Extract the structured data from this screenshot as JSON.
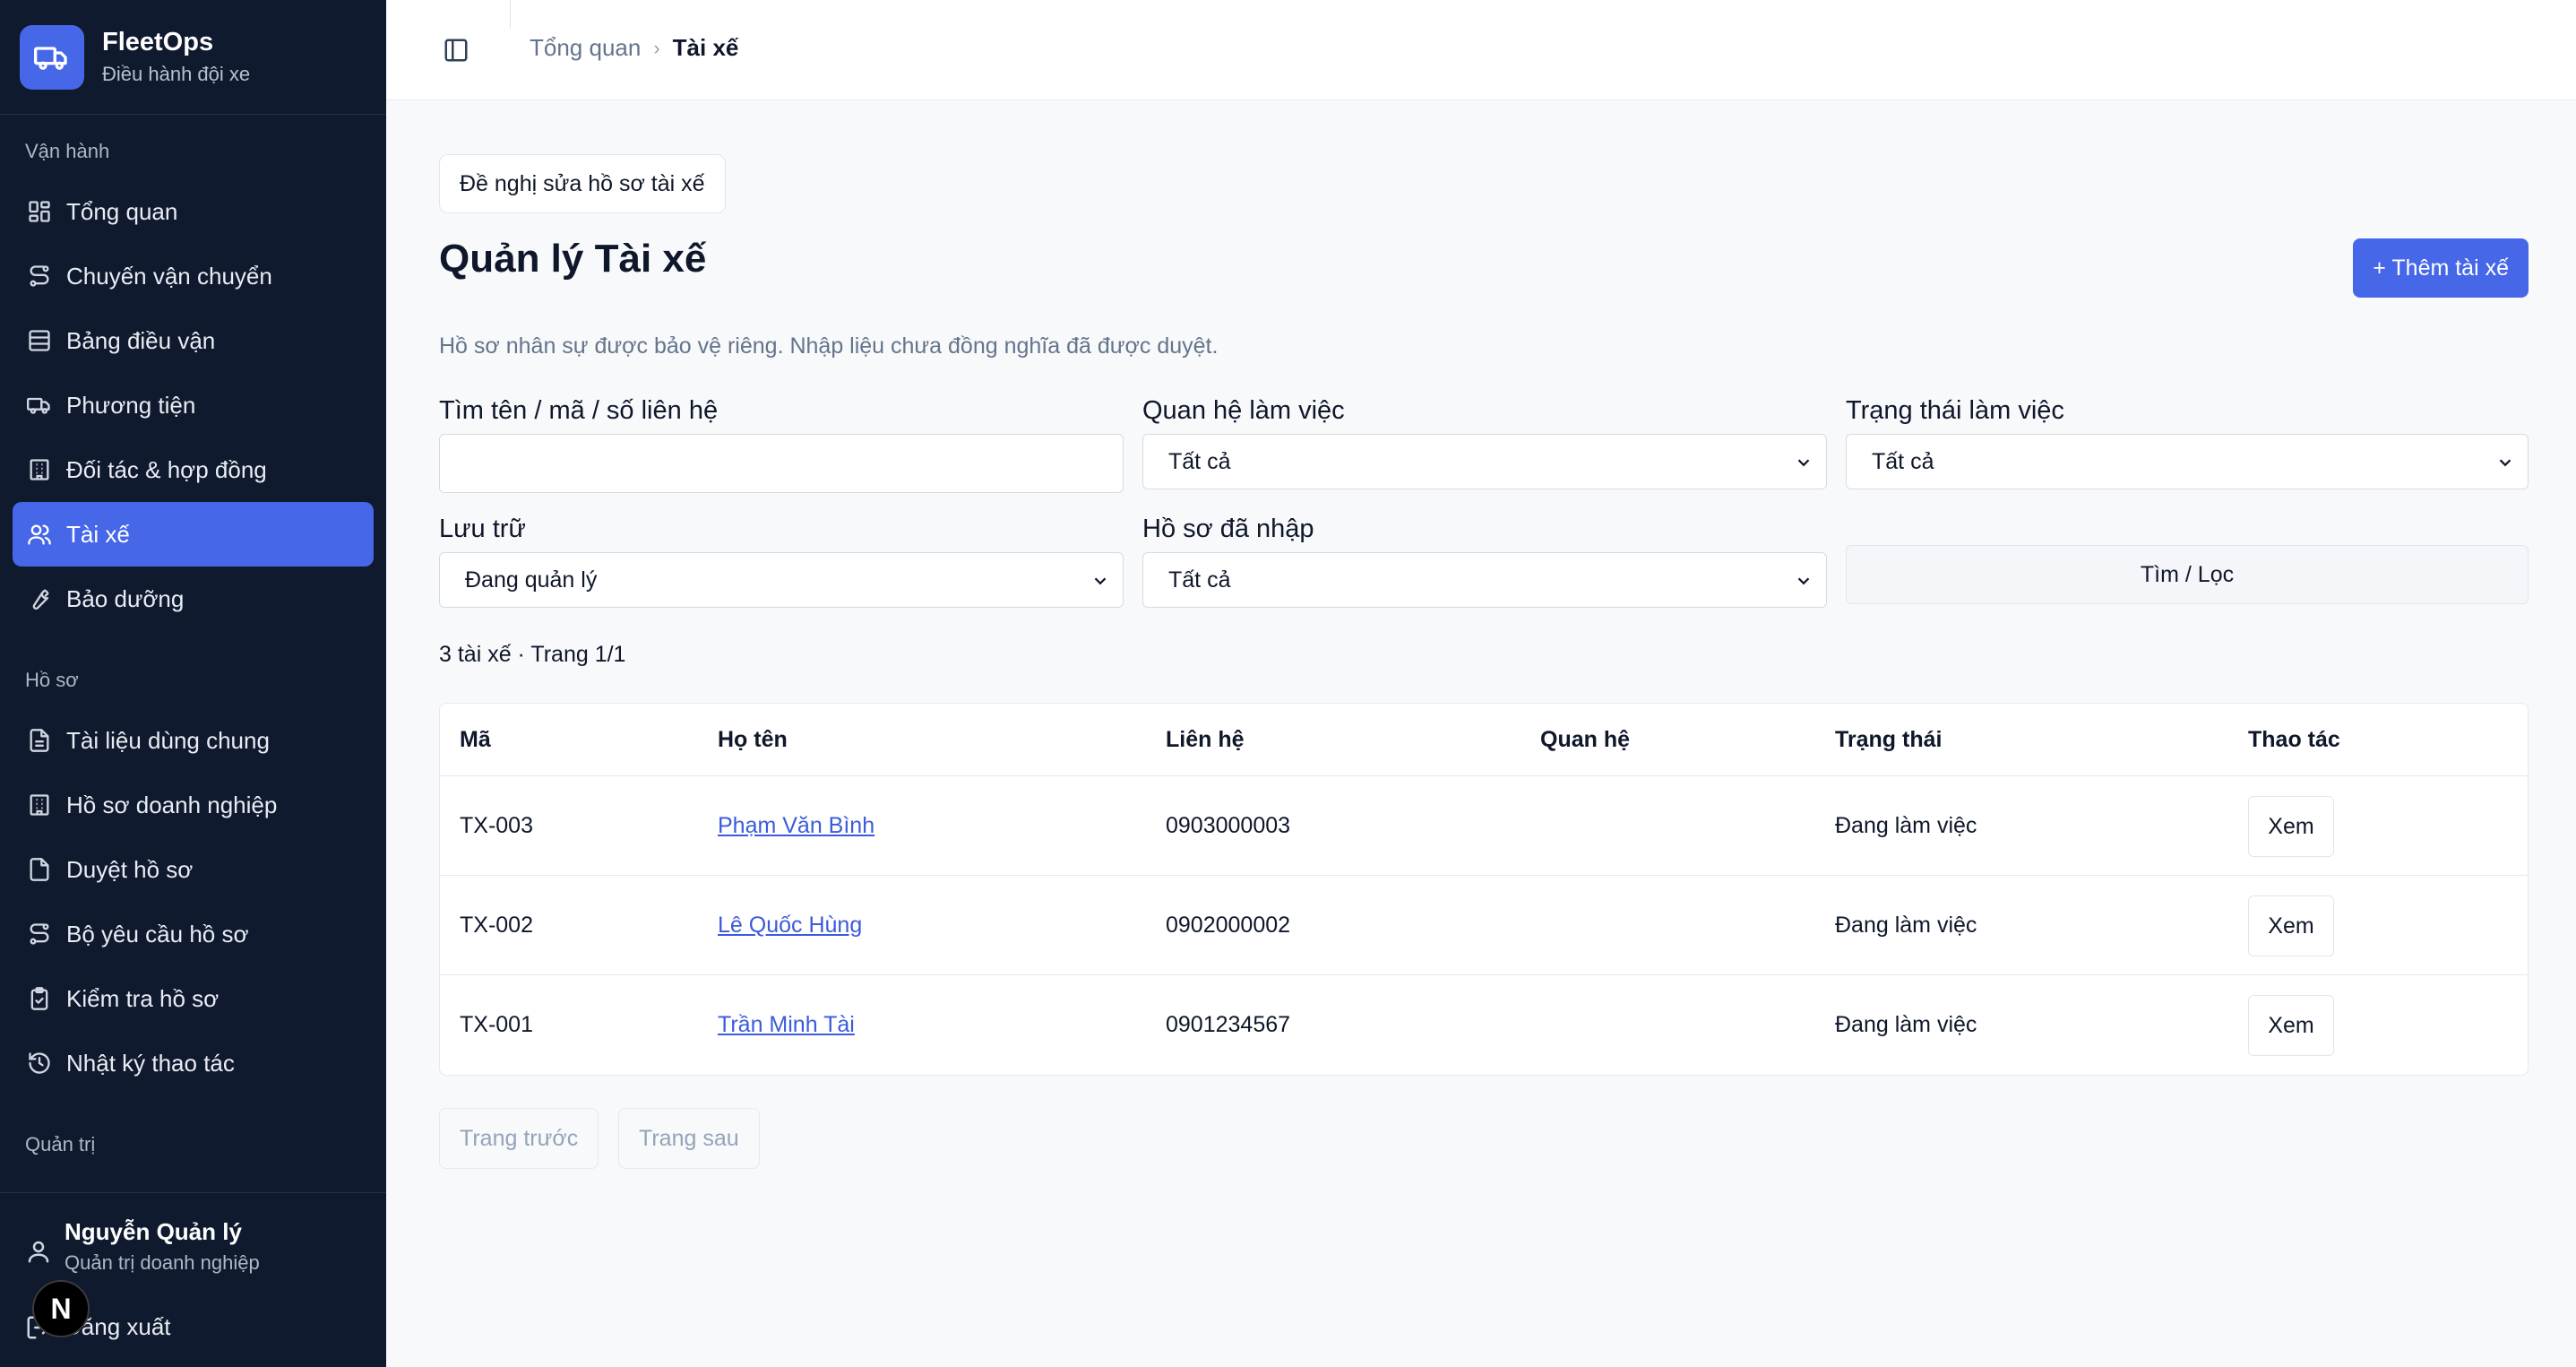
{
  "brand": {
    "name": "FleetOps",
    "subtitle": "Điều hành đội xe",
    "color": "#4567e8"
  },
  "sidebar": {
    "sections": [
      {
        "label": "Vận hành"
      },
      {
        "label": "Hồ sơ"
      },
      {
        "label": "Quản trị"
      }
    ],
    "items": [
      {
        "label": "Tổng quan",
        "icon": "dashboard-icon"
      },
      {
        "label": "Chuyến vận chuyển",
        "icon": "route-icon"
      },
      {
        "label": "Bảng điều vận",
        "icon": "table-icon"
      },
      {
        "label": "Phương tiện",
        "icon": "truck-icon"
      },
      {
        "label": "Đối tác & hợp đồng",
        "icon": "building-icon"
      },
      {
        "label": "Tài xế",
        "icon": "users-icon",
        "active": true
      },
      {
        "label": "Bảo dưỡng",
        "icon": "wrench-icon"
      },
      {
        "label": "Tài liệu dùng chung",
        "icon": "document-icon"
      },
      {
        "label": "Hồ sơ doanh nghiệp",
        "icon": "building-icon"
      },
      {
        "label": "Duyệt hồ sơ",
        "icon": "file-check-icon"
      },
      {
        "label": "Bộ yêu cầu hồ sơ",
        "icon": "route-icon"
      },
      {
        "label": "Kiểm tra hồ sơ",
        "icon": "clipboard-check-icon"
      },
      {
        "label": "Nhật ký thao tác",
        "icon": "history-icon"
      }
    ],
    "user": {
      "name": "Nguyễn Quản lý",
      "role": "Quản trị doanh nghiệp"
    },
    "logout_label": "Đăng xuất",
    "badge_letter": "N"
  },
  "breadcrumb": {
    "home": "Tổng quan",
    "current": "Tài xế"
  },
  "main": {
    "pill_label": "Đề nghị sửa hồ sơ tài xế",
    "title": "Quản lý Tài xế",
    "add_button": "+ Thêm tài xế",
    "subtitle": "Hồ sơ nhân sự được bảo vệ riêng. Nhập liệu chưa đồng nghĩa đã được duyệt."
  },
  "filters": {
    "search": {
      "label": "Tìm tên / mã / số liên hệ",
      "value": ""
    },
    "relation": {
      "label": "Quan hệ làm việc",
      "value": "Tất cả"
    },
    "status": {
      "label": "Trạng thái làm việc",
      "value": "Tất cả"
    },
    "archive": {
      "label": "Lưu trữ",
      "value": "Đang quản lý"
    },
    "entered": {
      "label": "Hồ sơ đã nhập",
      "value": "Tất cả"
    },
    "submit_label": "Tìm / Lọc"
  },
  "result_count": "3 tài xế · Trang 1/1",
  "table": {
    "headers": [
      "Mã",
      "Họ tên",
      "Liên hệ",
      "Quan hệ",
      "Trạng thái",
      "Thao tác"
    ],
    "rows": [
      {
        "code": "TX-003",
        "name": "Phạm Văn Bình",
        "phone": "0903000003",
        "relation": "",
        "status": "Đang làm việc",
        "action": "Xem"
      },
      {
        "code": "TX-002",
        "name": "Lê Quốc Hùng",
        "phone": "0902000002",
        "relation": "",
        "status": "Đang làm việc",
        "action": "Xem"
      },
      {
        "code": "TX-001",
        "name": "Trần Minh Tài",
        "phone": "0901234567",
        "relation": "",
        "status": "Đang làm việc",
        "action": "Xem"
      }
    ]
  },
  "pagination": {
    "prev": "Trang trước",
    "next": "Trang sau"
  }
}
